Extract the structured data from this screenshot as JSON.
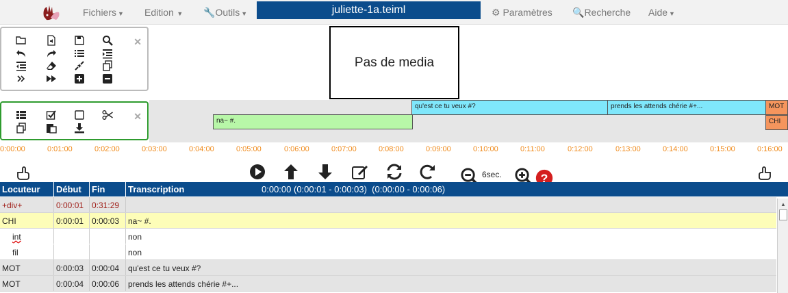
{
  "topbar": {
    "menus": [
      "Fichiers",
      "Edition",
      "Outils",
      "Paramètres",
      "Recherche",
      "Aide"
    ],
    "file_title": "juliette-1a.teiml"
  },
  "panel1": {
    "close_label": "✕"
  },
  "panel2": {
    "close_label": "✕"
  },
  "media": {
    "text": "Pas de media"
  },
  "timeline": {
    "segments": [
      {
        "speaker": "CHI",
        "text": "na~ #."
      },
      {
        "speaker": "MOT",
        "text": "qu'est ce tu veux #?"
      },
      {
        "speaker": "MOT",
        "text": "prends les attends chérie #+..."
      },
      {
        "speaker": "MOT",
        "text": "MOT"
      },
      {
        "speaker": "CHI",
        "text": "CHI"
      }
    ],
    "ticks": [
      "0:00:00",
      "0:01:00",
      "0:02:00",
      "0:03:00",
      "0:04:00",
      "0:05:00",
      "0:06:00",
      "0:07:00",
      "0:08:00",
      "0:09:00",
      "0:10:00",
      "0:11:00",
      "0:12:00",
      "0:13:00",
      "0:14:00",
      "0:15:00",
      "0:16:00"
    ]
  },
  "controls": {
    "zoom_label": "6sec."
  },
  "table": {
    "headers": {
      "speaker": "Locuteur",
      "start": "Début",
      "end": "Fin",
      "transcription": "Transcription"
    },
    "current_time": "0:00:00 (0:00:01 - 0:00:03)  (0:00:00 - 0:00:06)",
    "rows": [
      {
        "speaker": "+div+",
        "start": "0:00:01",
        "end": "0:31:29",
        "text": "",
        "style": "div"
      },
      {
        "speaker": "CHI",
        "start": "0:00:01",
        "end": "0:00:03",
        "text": "na~ #.",
        "style": "highlight"
      },
      {
        "speaker": "int",
        "start": "",
        "end": "",
        "text": "non",
        "style": "sub"
      },
      {
        "speaker": "fil",
        "start": "",
        "end": "",
        "text": "non",
        "style": "sub"
      },
      {
        "speaker": "MOT",
        "start": "0:00:03",
        "end": "0:00:04",
        "text": "qu'est ce tu veux #?",
        "style": "grey"
      },
      {
        "speaker": "MOT",
        "start": "0:00:04",
        "end": "0:00:06",
        "text": "prends les attends chérie #+...",
        "style": "grey"
      }
    ]
  },
  "colors": {
    "brand": "#0b4c8c",
    "highlight_row": "#fdfdb8",
    "grey_row": "#e4e4e4",
    "div_text": "#a0201a",
    "tick": "#f08a1a",
    "segment_green": "#b8f7a8",
    "segment_cyan": "#7fe7fb",
    "segment_orange": "#f5955d"
  }
}
